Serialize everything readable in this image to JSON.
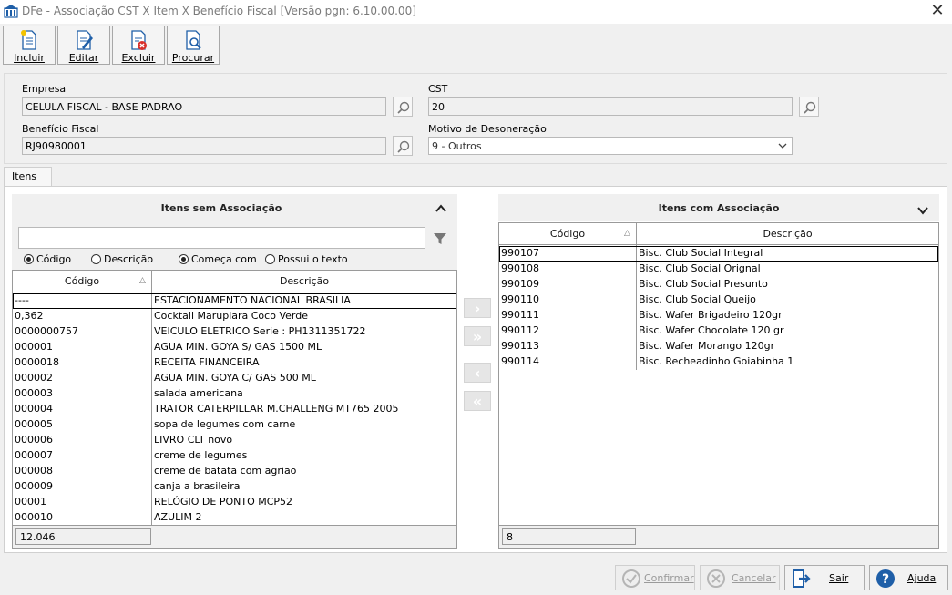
{
  "window": {
    "title": "DFe - Associação CST X Item X Benefício Fiscal [Versão pgn: 6.10.00.00]",
    "icon": "app-building-icon",
    "close_glyph": "✕"
  },
  "toolbar": {
    "items": [
      {
        "label": "Incluir",
        "icon": "new-document-icon"
      },
      {
        "label": "Editar",
        "icon": "edit-document-icon"
      },
      {
        "label": "Excluir",
        "icon": "delete-document-icon"
      },
      {
        "label": "Procurar",
        "icon": "search-document-icon"
      }
    ]
  },
  "form": {
    "empresa_label": "Empresa",
    "empresa_value": "CELULA FISCAL - BASE PADRAO",
    "cst_label": "CST",
    "cst_value": "20",
    "beneficio_label": "Benefício Fiscal",
    "beneficio_value": "RJ90980001",
    "motivo_label": "Motivo de Desoneração",
    "motivo_value": "9 - Outros"
  },
  "tabs": [
    {
      "label": "Itens",
      "active": true
    }
  ],
  "left": {
    "title": "Itens sem Associação",
    "search_value": "",
    "radios_field": [
      {
        "label": "Código",
        "checked": true
      },
      {
        "label": "Descrição",
        "checked": false
      }
    ],
    "radios_mode": [
      {
        "label": "Começa com",
        "checked": true
      },
      {
        "label": "Possui o texto",
        "checked": false
      }
    ],
    "columns": [
      "Código",
      "Descrição"
    ],
    "rows": [
      [
        "----",
        "ESTACIONAMENTO NACIONAL BRASILIA"
      ],
      [
        "0,362",
        "Cocktail Marupiara Coco Verde"
      ],
      [
        "0000000757",
        "VEICULO ELETRICO Serie : PH1311351722"
      ],
      [
        "000001",
        "AGUA MIN. GOYA S/ GAS 1500 ML"
      ],
      [
        "0000018",
        "RECEITA FINANCEIRA"
      ],
      [
        "000002",
        "AGUA MIN. GOYA C/ GAS  500 ML"
      ],
      [
        "000003",
        "salada americana"
      ],
      [
        "000004",
        "TRATOR CATERPILLAR M.CHALLENG MT765 2005"
      ],
      [
        "000005",
        "sopa de legumes com carne"
      ],
      [
        "000006",
        "LIVRO CLT novo"
      ],
      [
        "000007",
        "creme de legumes"
      ],
      [
        "000008",
        "creme de batata com agriao"
      ],
      [
        "000009",
        "canja a brasileira"
      ],
      [
        "00001",
        "RELÓGIO DE PONTO MCP52"
      ],
      [
        "000010",
        "AZULIM 2"
      ]
    ],
    "count": "12.046"
  },
  "right": {
    "title": "Itens com Associação",
    "columns": [
      "Código",
      "Descrição"
    ],
    "rows": [
      [
        "990107",
        "Bisc. Club Social Integral"
      ],
      [
        "990108",
        "Bisc. Club Social Orignal"
      ],
      [
        "990109",
        "Bisc. Club Social Presunto"
      ],
      [
        "990110",
        "Bisc. Club Social Queijo"
      ],
      [
        "990111",
        "Bisc. Wafer Brigadeiro 120gr"
      ],
      [
        "990112",
        "Bisc. Wafer Chocolate 120 gr"
      ],
      [
        "990113",
        "Bisc. Wafer Morango 120gr"
      ],
      [
        "990114",
        "Bisc. Recheadinho Goiabinha 1"
      ]
    ],
    "count": "8"
  },
  "move_buttons": [
    {
      "glyph": "›",
      "icon": "move-right-icon"
    },
    {
      "glyph": "»",
      "icon": "move-all-right-icon"
    },
    {
      "glyph": "‹",
      "icon": "move-left-icon"
    },
    {
      "glyph": "«",
      "icon": "move-all-left-icon"
    }
  ],
  "bottom": {
    "confirmar": "Confirmar",
    "cancelar": "Cancelar",
    "sair": "Sair",
    "ajuda": "Ajuda"
  },
  "colors": {
    "window_bg": "#f0f0f0",
    "icon_blue": "#1f5fa8",
    "delete_red": "#d9302c"
  }
}
